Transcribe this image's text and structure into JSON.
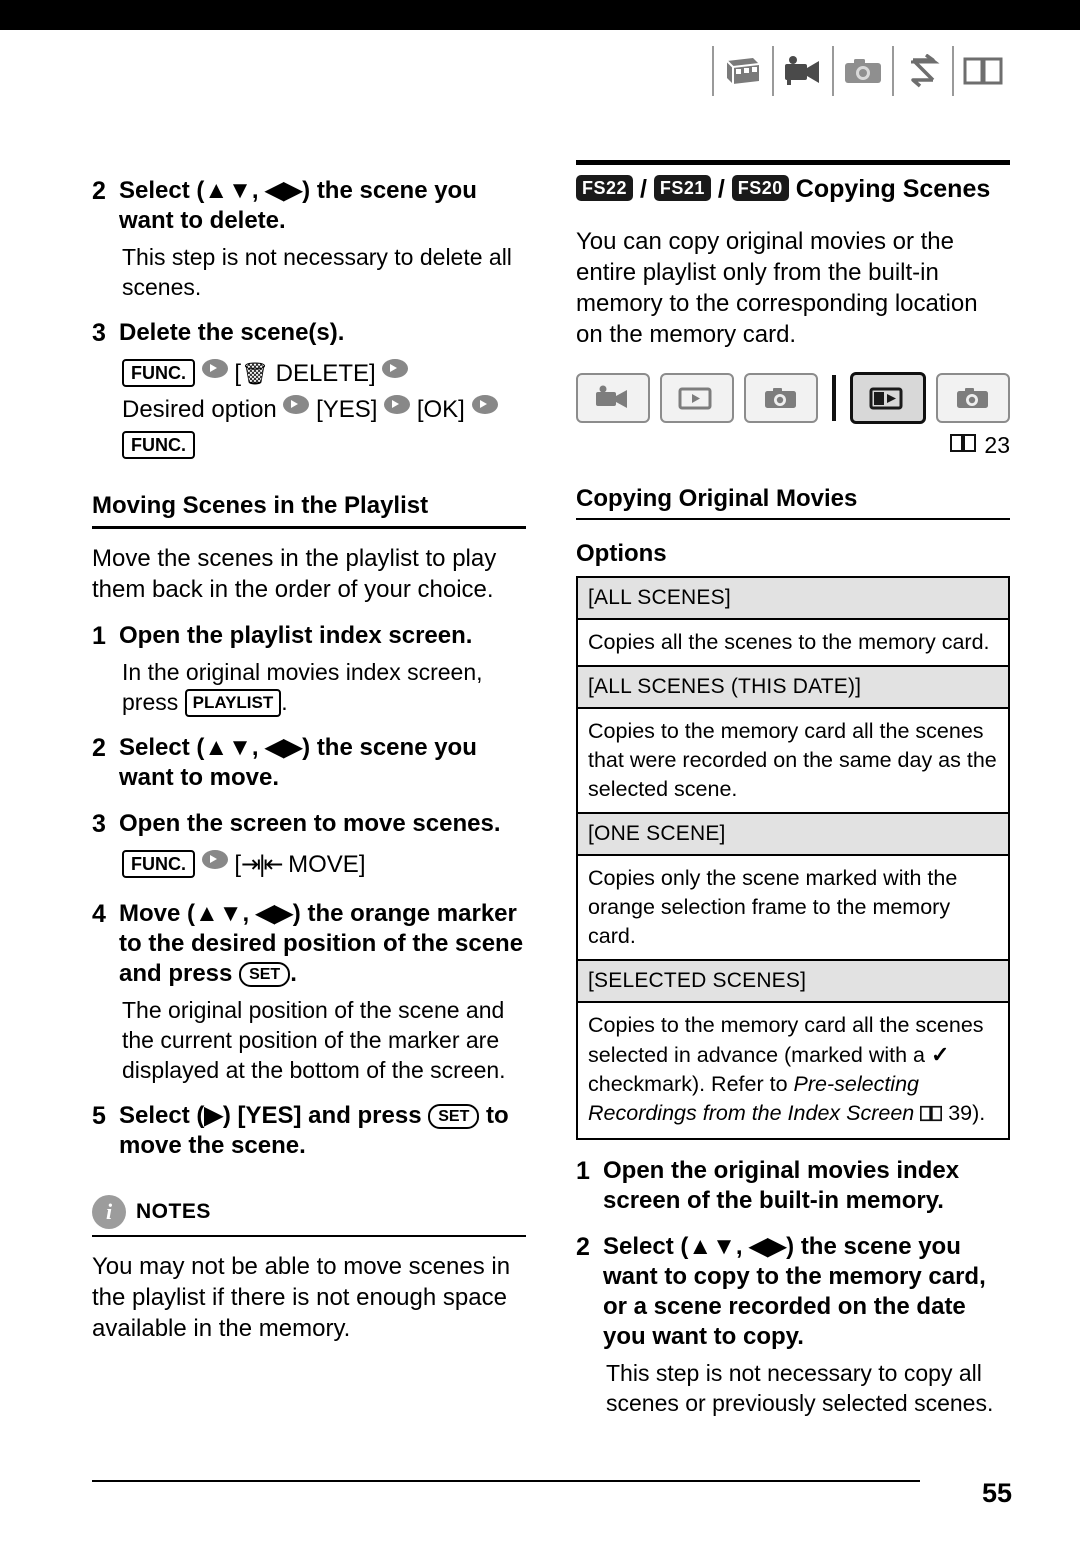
{
  "header": {
    "icons": [
      "film-strip-icon",
      "camcorder-icon",
      "photo-camera-icon",
      "transfer-arrows-icon",
      "book-icon"
    ]
  },
  "left_column": {
    "step2": {
      "num": "2",
      "text_prefix": "Select (",
      "text_suffix": ") the scene you want to delete.",
      "body": "This step is not necessary to delete all scenes."
    },
    "step3": {
      "num": "3",
      "text": "Delete the scene(s).",
      "seq_func": "FUNC.",
      "seq_delete": "[    DELETE]",
      "seq_desired": "Desired option",
      "seq_yes": "[YES]",
      "seq_ok": "[OK]",
      "seq_func2": "FUNC."
    },
    "section_head": "Moving Scenes in the Playlist",
    "intro": "Move the scenes in the playlist to play them back in the order of your choice.",
    "step1": {
      "num": "1",
      "text": "Open the playlist index screen.",
      "body_pre": "In the original movies index screen, press",
      "playlist_btn": "PLAYLIST",
      "body_post": "."
    },
    "step2b": {
      "num": "2",
      "text_prefix": "Select (",
      "text_suffix": ") the scene you want to move."
    },
    "step3b": {
      "num": "3",
      "text": "Open the screen to move scenes.",
      "seq_func": "FUNC.",
      "seq_move": "[    MOVE]"
    },
    "step4": {
      "num": "4",
      "text_prefix": "Move (",
      "text_mid": ") the orange marker to the desired position of the scene and press",
      "set_btn": "SET",
      "text_end": ".",
      "body": "The original position of the scene and the current position of the marker are displayed at the bottom of the screen."
    },
    "step5": {
      "num": "5",
      "text_prefix": "Select (",
      "text_mid": ") [YES] and press",
      "set_btn": "SET",
      "text_end": "to move the scene."
    },
    "notes": {
      "title": "NOTES",
      "body": "You may not be able to move scenes in the playlist if there is not enough space available in the memory."
    }
  },
  "right_column": {
    "title_badges": [
      "FS22",
      "FS21",
      "FS20"
    ],
    "title": "Copying Scenes",
    "intro": "You can copy original movies or the entire playlist only from the built-in memory to the corresponding location on the memory card.",
    "device_bar": {
      "buttons": [
        "movie-record-icon",
        "movie-play-icon",
        "photo-record-icon",
        "memory-movie-play-icon",
        "memory-photo-play-icon"
      ],
      "active_index": 3
    },
    "page_ref": "23",
    "sub_head": "Copying Original Movies",
    "options_label": "Options",
    "options": [
      {
        "key": "[ALL SCENES]",
        "value": "Copies all the scenes to the memory card."
      },
      {
        "key": "[ALL SCENES (THIS DATE)]",
        "value": "Copies to the memory card all the scenes that were recorded on the same day as the selected scene."
      },
      {
        "key": "[ONE SCENE]",
        "value": "Copies only the scene marked with the orange selection frame to the memory card."
      },
      {
        "key": "[SELECTED SCENES]",
        "value_part1": "Copies to the memory card all the scenes selected in advance (marked with a",
        "value_part2": "checkmark). Refer to",
        "value_italic": "Pre-selecting Recordings from the Index Screen",
        "value_pageref": "39",
        "value_end": ")."
      }
    ],
    "step1": {
      "num": "1",
      "text": "Open the original movies index screen of the built-in memory."
    },
    "step2": {
      "num": "2",
      "text_prefix": "Select (",
      "text_suffix": ") the scene you want to copy to the memory card, or a scene recorded on the date you want to copy.",
      "body": "This step is not necessary to copy all scenes or previously selected scenes."
    }
  },
  "footer": {
    "page_number": "55"
  }
}
